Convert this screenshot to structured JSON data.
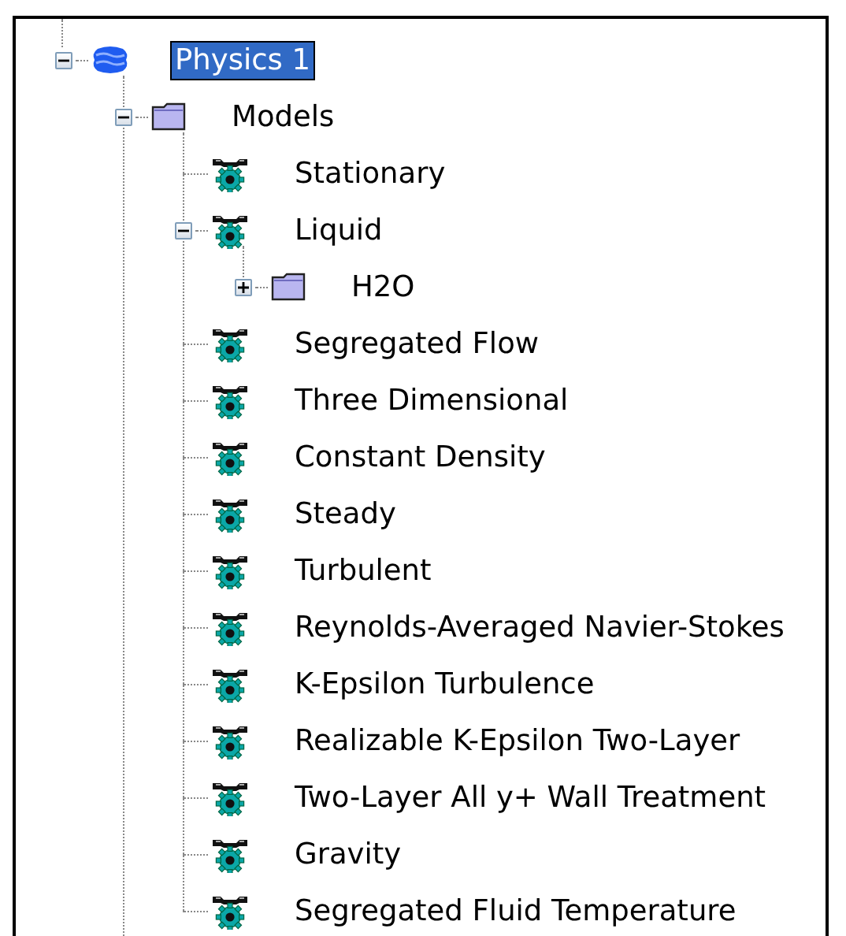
{
  "tree": [
    {
      "label": "Physics 1",
      "kind": "physics",
      "expanded": true,
      "selected": true,
      "children": [
        {
          "label": "Models",
          "kind": "folder",
          "expanded": true,
          "selected": false,
          "children": [
            {
              "label": "Stationary",
              "kind": "model",
              "selected": false
            },
            {
              "label": "Liquid",
              "kind": "model",
              "expanded": true,
              "selected": false,
              "children": [
                {
                  "label": "H2O",
                  "kind": "folder",
                  "expanded": false,
                  "selected": false
                }
              ]
            },
            {
              "label": "Segregated Flow",
              "kind": "model",
              "selected": false
            },
            {
              "label": "Three Dimensional",
              "kind": "model",
              "selected": false
            },
            {
              "label": "Constant Density",
              "kind": "model",
              "selected": false
            },
            {
              "label": "Steady",
              "kind": "model",
              "selected": false
            },
            {
              "label": "Turbulent",
              "kind": "model",
              "selected": false
            },
            {
              "label": "Reynolds-Averaged Navier-Stokes",
              "kind": "model",
              "selected": false
            },
            {
              "label": "K-Epsilon Turbulence",
              "kind": "model",
              "selected": false
            },
            {
              "label": "Realizable K-Epsilon Two-Layer",
              "kind": "model",
              "selected": false
            },
            {
              "label": "Two-Layer All y+ Wall Treatment",
              "kind": "model",
              "selected": false
            },
            {
              "label": "Gravity",
              "kind": "model",
              "selected": false
            },
            {
              "label": "Segregated Fluid Temperature",
              "kind": "model",
              "selected": false
            }
          ]
        }
      ]
    }
  ]
}
